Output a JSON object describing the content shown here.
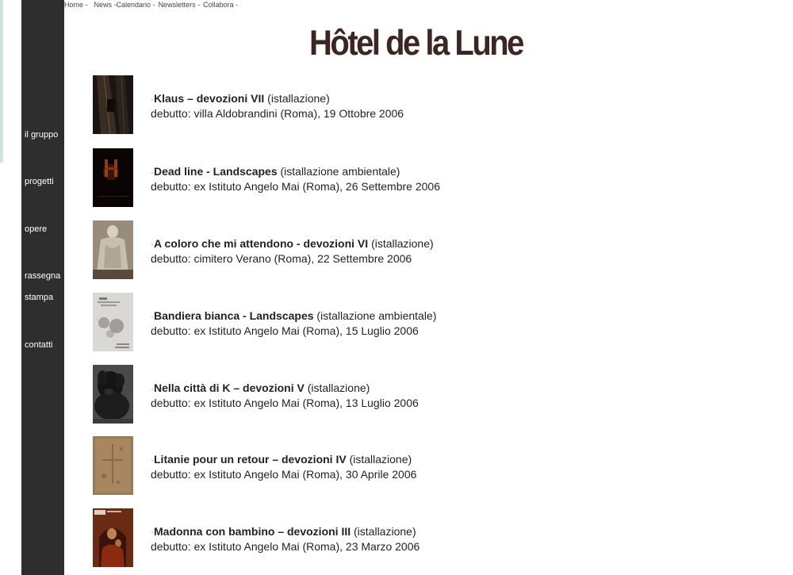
{
  "topnav": [
    "Home -",
    "News -",
    "Calendario -",
    "Newsletters -",
    "Collabora -"
  ],
  "site": {
    "logo_text": "Hôtel de la Lune"
  },
  "sidebar": {
    "items": [
      "il gruppo",
      "progetti",
      "opere",
      "rassegna",
      "stampa",
      "contatti"
    ]
  },
  "works": [
    {
      "title": "Klaus – devozioni VII",
      "type": "(istallazione)",
      "debut": "debutto: villa Aldobrandini (Roma), 19 Ottobre 2006",
      "thumb_icon": "dark-corridor-photo"
    },
    {
      "title": "Dead line - Landscapes",
      "type": "(istallazione ambientale)",
      "debut": "debutto: ex Istituto Angelo Mai (Roma), 26 Settembre 2006",
      "thumb_icon": "dark-candlelight-photo"
    },
    {
      "title": "A coloro che mi attendono - devozioni VI",
      "type": "(istallazione)",
      "debut": "debutto: cimitero Verano (Roma), 22 Settembre 2006",
      "thumb_icon": "statue-photo"
    },
    {
      "title": "Bandiera bianca - Landscapes",
      "type": "(istallazione ambientale)",
      "debut": "debutto: ex Istituto Angelo Mai (Roma), 15 Luglio 2006",
      "thumb_icon": "flyer-photo"
    },
    {
      "title": "Nella città di K – devozioni V",
      "type": "(istallazione)",
      "debut": "debutto: ex Istituto Angelo Mai (Roma), 13 Luglio 2006",
      "thumb_icon": "dog-photo"
    },
    {
      "title": "Litanie pour un retour – devozioni IV",
      "type": "(istallazione)",
      "debut": "debutto: ex Istituto Angelo Mai (Roma), 30 Aprile 2006",
      "thumb_icon": "parchment-photo"
    },
    {
      "title": "Madonna con bambino – devozioni III",
      "type": "(istallazione)",
      "debut": "debutto: ex Istituto Angelo Mai (Roma), 23 Marzo 2006",
      "thumb_icon": "madonna-icon-photo"
    }
  ],
  "colors": {
    "sidebar_bg": "#2e2e2e",
    "logo": "#3b2622",
    "left_edge": "#cde6e4"
  }
}
